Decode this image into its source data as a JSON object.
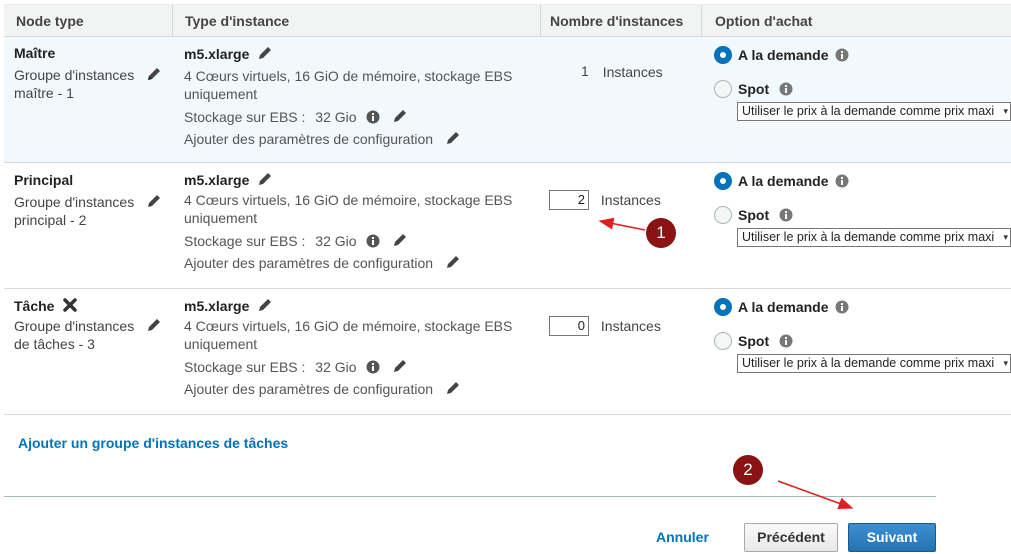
{
  "header": {
    "node_type": "Node type",
    "instance_type": "Type d'instance",
    "instance_count": "Nombre d'instances",
    "purchase_option": "Option d'achat"
  },
  "rows": [
    {
      "node_title": "Maître",
      "node_sub": "Groupe d'instances maître - 1",
      "instance_type": "m5.xlarge",
      "instance_desc": "4 Cœurs virtuels, 16 GiO de mémoire, stockage EBS uniquement",
      "ebs_label": "Stockage sur EBS :",
      "ebs_value": "32 Gio",
      "config_link": "Ajouter des paramètres de configuration",
      "count": "1",
      "count_label": "Instances",
      "on_demand": "A la demande",
      "spot": "Spot",
      "price_select": "Utiliser le prix à la demande comme prix maxi"
    },
    {
      "node_title": "Principal",
      "node_sub": "Groupe d'instances principal - 2",
      "instance_type": "m5.xlarge",
      "instance_desc": "4 Cœurs virtuels, 16 GiO de mémoire, stockage EBS uniquement",
      "ebs_label": "Stockage sur EBS :",
      "ebs_value": "32 Gio",
      "config_link": "Ajouter des paramètres de configuration",
      "count": "2",
      "count_label": "Instances",
      "on_demand": "A la demande",
      "spot": "Spot",
      "price_select": "Utiliser le prix à la demande comme prix maxi"
    },
    {
      "node_title": "Tâche",
      "node_sub": "Groupe d'instances de tâches - 3",
      "instance_type": "m5.xlarge",
      "instance_desc": "4 Cœurs virtuels, 16 GiO de mémoire, stockage EBS uniquement",
      "ebs_label": "Stockage sur EBS :",
      "ebs_value": "32 Gio",
      "config_link": "Ajouter des paramètres de configuration",
      "count": "0",
      "count_label": "Instances",
      "on_demand": "A la demande",
      "spot": "Spot",
      "price_select": "Utiliser le prix à la demande comme prix maxi"
    }
  ],
  "add_task_group": "Ajouter un groupe d'instances de tâches",
  "footer": {
    "cancel": "Annuler",
    "previous": "Précédent",
    "next": "Suivant"
  },
  "annotations": {
    "badge_1": "1",
    "badge_2": "2"
  },
  "colors": {
    "accent": "#0073bb",
    "annotation": "#8a1212",
    "arrow": "#e02020",
    "selected_row": "#f1f8fe"
  },
  "icons": {
    "edit": "pencil-icon",
    "remove": "close-icon",
    "info": "info-icon"
  }
}
